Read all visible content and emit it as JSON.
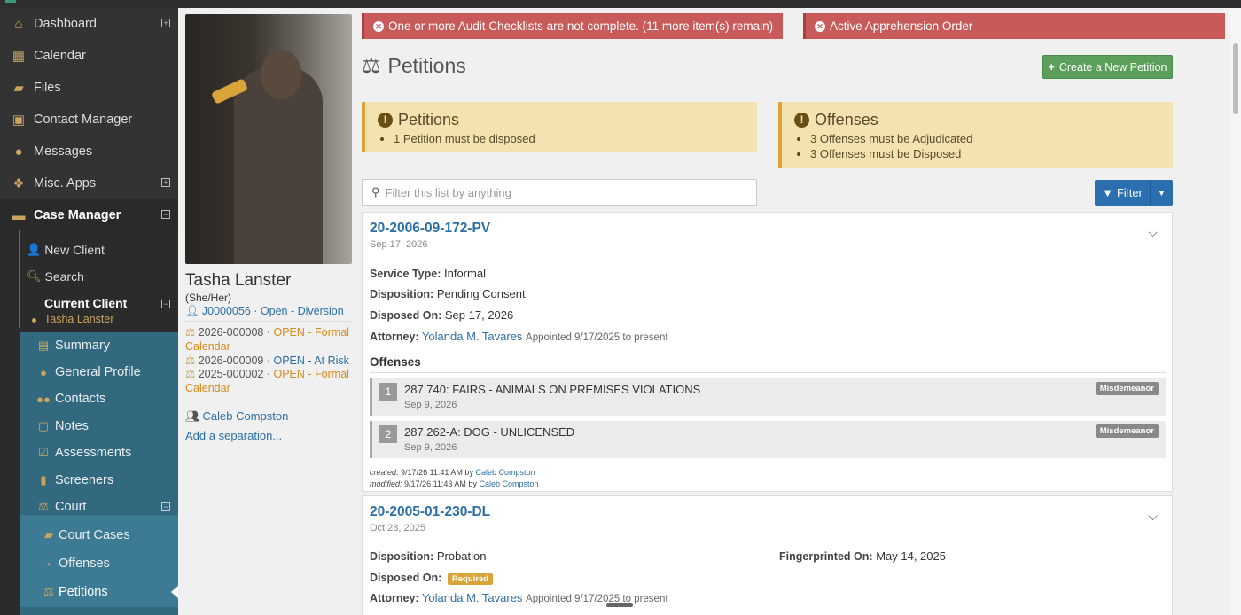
{
  "sidebar": {
    "items": [
      {
        "label": "Dashboard",
        "icon": "home-icon"
      },
      {
        "label": "Calendar",
        "icon": "calendar-icon"
      },
      {
        "label": "Files",
        "icon": "folder-icon"
      },
      {
        "label": "Contact Manager",
        "icon": "contact-card-icon"
      },
      {
        "label": "Messages",
        "icon": "chat-icon"
      },
      {
        "label": "Misc. Apps",
        "icon": "cubes-icon"
      },
      {
        "label": "Case Manager",
        "icon": "briefcase-icon"
      }
    ],
    "case_manager_sub": [
      {
        "label": "New Client"
      },
      {
        "label": "Search"
      }
    ],
    "current_client": {
      "label": "Current Client",
      "name": "Tasha Lanster"
    },
    "client_menu": [
      {
        "label": "Summary"
      },
      {
        "label": "General Profile"
      },
      {
        "label": "Contacts"
      },
      {
        "label": "Notes"
      },
      {
        "label": "Assessments"
      },
      {
        "label": "Screeners"
      },
      {
        "label": "Court"
      }
    ],
    "court_menu": [
      {
        "label": "Court Cases"
      },
      {
        "label": "Offenses"
      },
      {
        "label": "Petitions"
      }
    ]
  },
  "client": {
    "name": "Tasha Lanster",
    "pronouns": "(She/Her)",
    "id_line": "J0000056 · Open - Diversion",
    "cases": [
      {
        "num": "2026-000008 · ",
        "status": "OPEN - Formal Calendar",
        "color": "orange"
      },
      {
        "num": "2026-000009 · ",
        "status": "OPEN - At Risk",
        "color": "blue"
      },
      {
        "num": "2025-000002 · ",
        "status": "OPEN - Formal Calendar",
        "color": "orange"
      }
    ],
    "worker": "Caleb Compston",
    "add_separation": "Add a separation..."
  },
  "alerts": {
    "audit": "One or more Audit Checklists are not complete. (11 more item(s) remain)",
    "apprehension": "Active Apprehension Order"
  },
  "page": {
    "title": "Petitions",
    "create_button": "Create a New Petition"
  },
  "warnings": {
    "petitions": {
      "title": "Petitions",
      "items": [
        "1 Petition must be disposed"
      ]
    },
    "offenses": {
      "title": "Offenses",
      "items": [
        "3 Offenses must be Adjudicated",
        "3 Offenses must be Disposed"
      ]
    }
  },
  "filter": {
    "placeholder": "Filter this list by anything",
    "button": "Filter"
  },
  "petitions": [
    {
      "id": "20-2006-09-172-PV",
      "date": "Sep 17, 2026",
      "service_type_label": "Service Type:",
      "service_type": "Informal",
      "disposition_label": "Disposition:",
      "disposition": "Pending Consent",
      "disposed_on_label": "Disposed On:",
      "disposed_on": "Sep 17, 2026",
      "attorney_label": "Attorney:",
      "attorney": "Yolanda M. Tavares",
      "appointed": "Appointed 9/17/2025 to present",
      "offenses_title": "Offenses",
      "offenses": [
        {
          "num": "1",
          "title": "287.740: FAIRS - ANIMALS ON PREMISES VIOLATIONS",
          "date": "Sep 9, 2026",
          "badge": "Misdemeanor"
        },
        {
          "num": "2",
          "title": "287.262-A: DOG - UNLICENSED",
          "date": "Sep 9, 2026",
          "badge": "Misdemeanor"
        }
      ],
      "created_label": "created:",
      "created": "9/17/26 11:41 AM by",
      "created_by": "Caleb Compston",
      "modified_label": "modified:",
      "modified": "9/17/26 11:43 AM by",
      "modified_by": "Caleb Compston"
    },
    {
      "id": "20-2005-01-230-DL",
      "date": "Oct 28, 2025",
      "disposition_label": "Disposition:",
      "disposition": "Probation",
      "fingerprinted_label": "Fingerprinted On:",
      "fingerprinted": "May 14, 2025",
      "disposed_on_label": "Disposed On:",
      "disposed_badge": "Required",
      "attorney_label": "Attorney:",
      "attorney": "Yolanda M. Tavares",
      "appointed": "Appointed 9/17/2025 to present"
    }
  ],
  "colors": {
    "sidebar_bg": "#333333",
    "client_menu_bg": "#33697f",
    "accent_gold": "#c9a560",
    "alert_red": "#c95a5a",
    "warning_bg": "#f3e3b0",
    "link_blue": "#2c6fa6",
    "create_green": "#5aa05a"
  }
}
